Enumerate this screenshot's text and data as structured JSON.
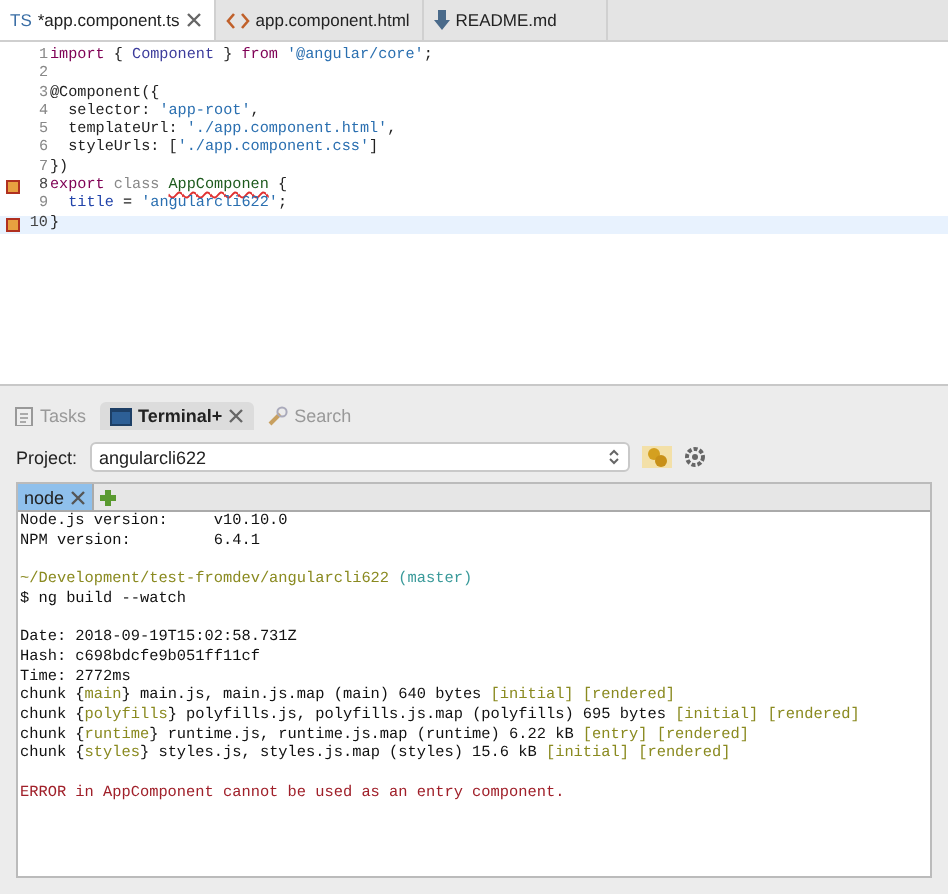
{
  "editor_tabs": [
    {
      "badge": "TS",
      "label": "*app.component.ts",
      "selected": true,
      "closable": true
    },
    {
      "label": "app.component.html",
      "selected": false,
      "closable": false
    },
    {
      "label": "README.md",
      "selected": false,
      "closable": false
    }
  ],
  "code_lines": [
    {
      "number": "1",
      "marker": false,
      "current": false,
      "tokens": [
        {
          "kind": "keyword",
          "text": "import"
        },
        {
          "kind": "plain",
          "text": " { "
        },
        {
          "kind": "type",
          "text": "Component"
        },
        {
          "kind": "plain",
          "text": " } "
        },
        {
          "kind": "keyword",
          "text": "from "
        },
        {
          "kind": "string",
          "text": "'@angular/core'"
        },
        {
          "kind": "plain",
          "text": ";"
        }
      ]
    },
    {
      "number": "2",
      "marker": false,
      "current": false
    },
    {
      "number": "3",
      "marker": false,
      "current": false,
      "tokens": [
        {
          "kind": "plain",
          "text": "@Component({"
        }
      ]
    },
    {
      "number": "4",
      "marker": false,
      "current": false,
      "tokens": [
        {
          "kind": "plain",
          "text": "  selector: "
        },
        {
          "kind": "string",
          "text": "'app-root'"
        },
        {
          "kind": "plain",
          "text": ","
        }
      ]
    },
    {
      "number": "5",
      "marker": false,
      "current": false,
      "tokens": [
        {
          "kind": "plain",
          "text": "  templateUrl: "
        },
        {
          "kind": "string",
          "text": "'./app.component.html'"
        },
        {
          "kind": "plain",
          "text": ","
        }
      ]
    },
    {
      "number": "6",
      "marker": false,
      "current": false,
      "tokens": [
        {
          "kind": "plain",
          "text": "  styleUrls: ["
        },
        {
          "kind": "string",
          "text": "'./app.component.css'"
        },
        {
          "kind": "plain",
          "text": "]"
        }
      ]
    },
    {
      "number": "7",
      "marker": false,
      "current": false,
      "tokens": [
        {
          "kind": "plain",
          "text": "})"
        }
      ]
    },
    {
      "number": "8",
      "marker": true,
      "current": false,
      "tokens": [
        {
          "kind": "keyword",
          "text": "export "
        },
        {
          "kind": "muted",
          "text": "class "
        },
        {
          "kind": "error",
          "text": "AppComponen"
        },
        {
          "kind": "plain",
          "text": " {"
        }
      ]
    },
    {
      "number": "9",
      "marker": false,
      "current": false,
      "tokens": [
        {
          "kind": "field",
          "text": "  title"
        },
        {
          "kind": "plain",
          "text": " = "
        },
        {
          "kind": "string",
          "text": "'angularcli622'"
        },
        {
          "kind": "plain",
          "text": ";"
        }
      ]
    },
    {
      "number": "10",
      "marker": true,
      "current": true,
      "tokens": [
        {
          "kind": "plain",
          "text": "}"
        }
      ]
    }
  ],
  "view_tabs": [
    {
      "label": "Tasks",
      "selected": false,
      "closable": false
    },
    {
      "label": "Terminal+",
      "selected": true,
      "closable": true
    },
    {
      "label": "Search",
      "selected": false,
      "closable": false
    }
  ],
  "project": {
    "label": "Project:",
    "value": "angularcli622"
  },
  "terminal_tabs": [
    {
      "label": "node",
      "selected": true,
      "closable": true
    }
  ],
  "terminal_lines": [
    {
      "space_before": false,
      "tokens": [
        {
          "kind": "plain",
          "text": "Node.js version:     v10.10.0"
        }
      ]
    },
    {
      "space_before": false,
      "tokens": [
        {
          "kind": "plain",
          "text": "NPM version:         6.4.1"
        }
      ]
    },
    {
      "space_before": true,
      "tokens": [
        {
          "kind": "olive",
          "text": "~/Development/test-fromdev/angularcli622 "
        },
        {
          "kind": "cyan",
          "text": "(master)"
        }
      ]
    },
    {
      "space_before": false,
      "tokens": [
        {
          "kind": "plain",
          "text": "$ ng build --watch"
        }
      ]
    },
    {
      "space_before": true,
      "tokens": [
        {
          "kind": "plain",
          "text": "Date: 2018-09-19T15:02:58.731Z"
        }
      ]
    },
    {
      "space_before": false,
      "tokens": [
        {
          "kind": "plain",
          "text": "Hash: c698bdcfe9b051ff11cf"
        }
      ]
    },
    {
      "space_before": false,
      "tokens": [
        {
          "kind": "plain",
          "text": "Time: 2772ms"
        }
      ]
    },
    {
      "space_before": false,
      "tokens": [
        {
          "kind": "plain",
          "text": "chunk {"
        },
        {
          "kind": "olive",
          "text": "main"
        },
        {
          "kind": "plain",
          "text": "} main.js, main.js.map (main) 640 bytes "
        },
        {
          "kind": "olive",
          "text": "[initial] [rendered]"
        }
      ]
    },
    {
      "space_before": false,
      "tokens": [
        {
          "kind": "plain",
          "text": "chunk {"
        },
        {
          "kind": "olive",
          "text": "polyfills"
        },
        {
          "kind": "plain",
          "text": "} polyfills.js, polyfills.js.map (polyfills) 695 bytes "
        },
        {
          "kind": "olive",
          "text": "[initial] [rendered]"
        }
      ]
    },
    {
      "space_before": false,
      "tokens": [
        {
          "kind": "plain",
          "text": "chunk {"
        },
        {
          "kind": "olive",
          "text": "runtime"
        },
        {
          "kind": "plain",
          "text": "} runtime.js, runtime.js.map (runtime) 6.22 kB "
        },
        {
          "kind": "olive",
          "text": "[entry] [rendered]"
        }
      ]
    },
    {
      "space_before": false,
      "tokens": [
        {
          "kind": "plain",
          "text": "chunk {"
        },
        {
          "kind": "olive",
          "text": "styles"
        },
        {
          "kind": "plain",
          "text": "} styles.js, styles.js.map (styles) 15.6 kB "
        },
        {
          "kind": "olive",
          "text": "[initial] [rendered]"
        }
      ]
    },
    {
      "space_before": true,
      "tokens": [
        {
          "kind": "red",
          "text": "ERROR in AppComponent cannot be used as an entry component."
        }
      ]
    }
  ]
}
